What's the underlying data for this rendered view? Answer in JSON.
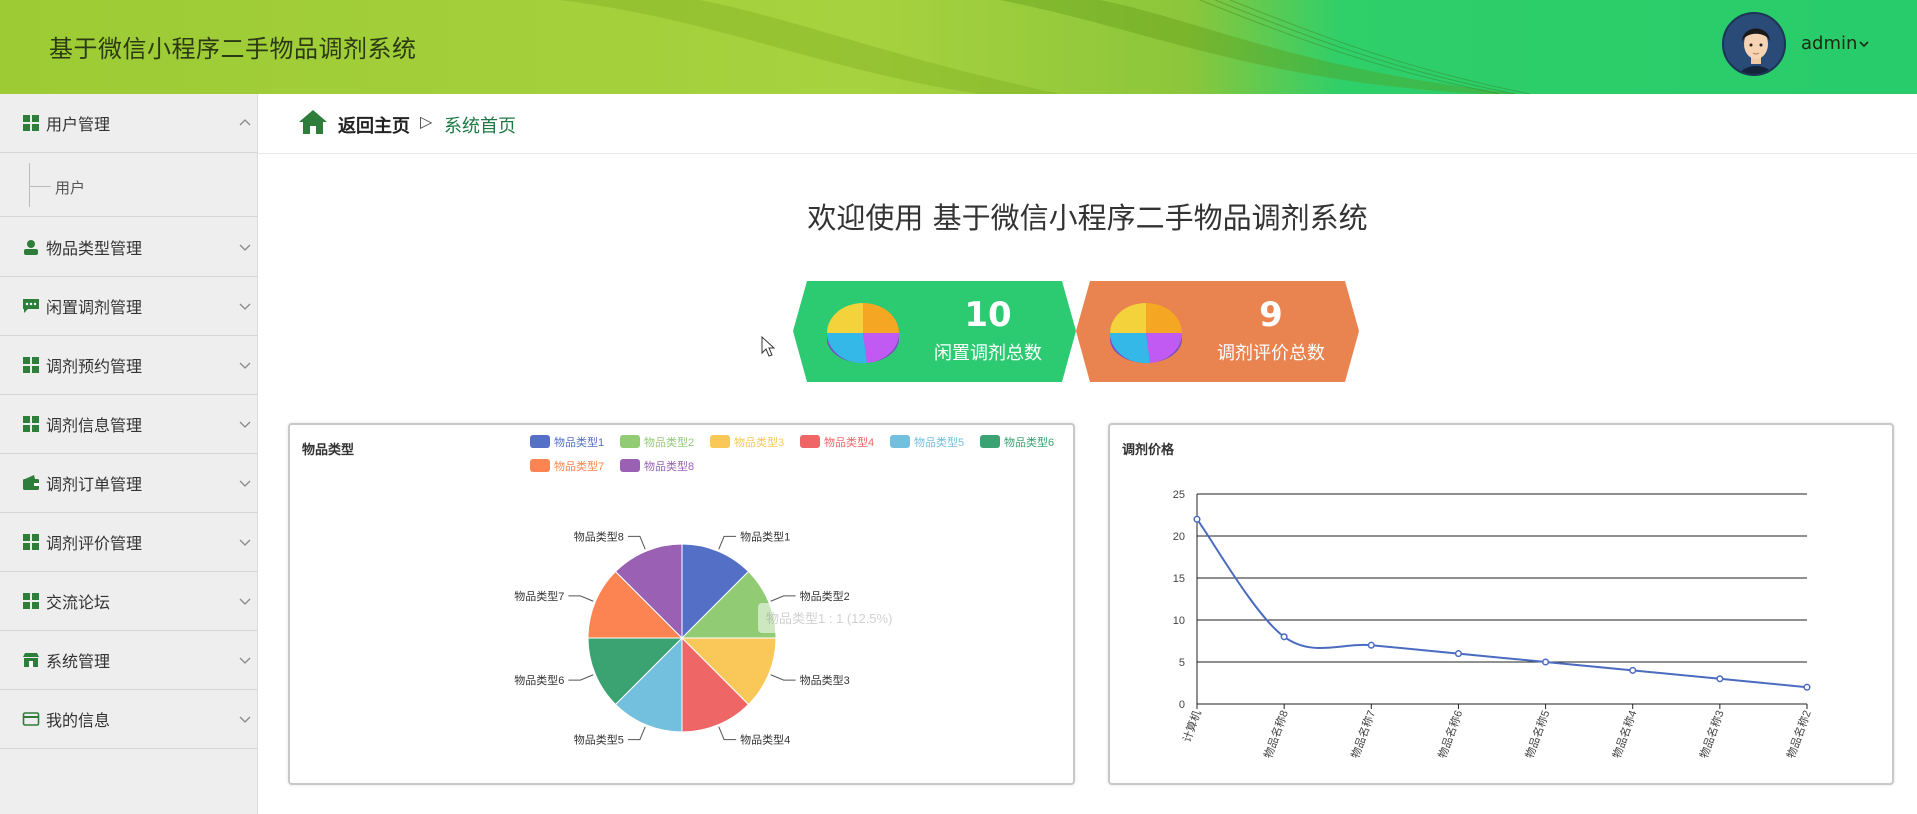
{
  "header": {
    "title": "基于微信小程序二手物品调剂系统",
    "user_name": "admin"
  },
  "sidebar": {
    "items": [
      {
        "label": "用户管理",
        "icon": "grid-icon",
        "expanded": true,
        "children": [
          "用户"
        ]
      },
      {
        "label": "物品类型管理",
        "icon": "user-icon"
      },
      {
        "label": "闲置调剂管理",
        "icon": "chat-icon"
      },
      {
        "label": "调剂预约管理",
        "icon": "grid-icon"
      },
      {
        "label": "调剂信息管理",
        "icon": "grid-icon"
      },
      {
        "label": "调剂订单管理",
        "icon": "wallet-icon"
      },
      {
        "label": "调剂评价管理",
        "icon": "grid-icon"
      },
      {
        "label": "交流论坛",
        "icon": "grid-icon"
      },
      {
        "label": "系统管理",
        "icon": "store-icon"
      },
      {
        "label": "我的信息",
        "icon": "card-icon"
      }
    ]
  },
  "breadcrumb": {
    "home": "返回主页",
    "separator": "▷",
    "current": "系统首页"
  },
  "welcome": "欢迎使用 基于微信小程序二手物品调剂系统",
  "stats": [
    {
      "value": "10",
      "label": "闲置调剂总数",
      "color": "#2ccb72"
    },
    {
      "value": "9",
      "label": "调剂评价总数",
      "color": "#e9834f"
    }
  ],
  "colors": {
    "accent_green": "#1e7a44",
    "line_series": "#4a6bbf"
  },
  "chart_data": [
    {
      "type": "pie",
      "title": "物品类型",
      "categories": [
        "物品类型1",
        "物品类型2",
        "物品类型3",
        "物品类型4",
        "物品类型5",
        "物品类型6",
        "物品类型7",
        "物品类型8"
      ],
      "values": [
        1,
        1,
        1,
        1,
        1,
        1,
        1,
        1
      ],
      "colors": [
        "#5470c6",
        "#91cc75",
        "#fac858",
        "#ee6666",
        "#73c0de",
        "#3ba272",
        "#fc8452",
        "#9a60b4"
      ],
      "legend": "top-right",
      "tooltip": "物品类型1 : 1 (12.5%)"
    },
    {
      "type": "line",
      "title": "调剂价格",
      "categories": [
        "计算机",
        "物品名称8",
        "物品名称7",
        "物品名称6",
        "物品名称5",
        "物品名称4",
        "物品名称3",
        "物品名称2"
      ],
      "values": [
        22,
        8,
        7,
        6,
        5,
        4,
        3,
        2
      ],
      "ylim": [
        0,
        25
      ],
      "yticks": [
        "0",
        "5",
        "10",
        "15",
        "20",
        "25"
      ],
      "grid": true,
      "smooth": true
    }
  ]
}
